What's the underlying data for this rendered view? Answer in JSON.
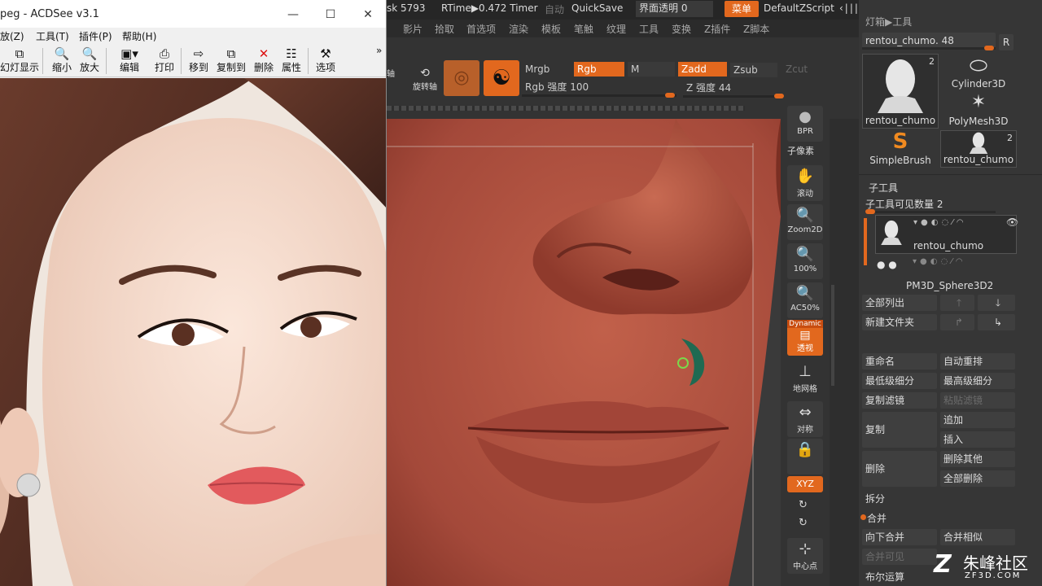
{
  "acdsee": {
    "title": "peg - ACDSee v3.1",
    "menu": [
      "放(Z)",
      "工具(T)",
      "插件(P)",
      "帮助(H)"
    ],
    "toolbar": [
      {
        "icon": "slideshow-icon",
        "label": "幻灯显示"
      },
      {
        "icon": "zoom-out-icon",
        "label": "缩小"
      },
      {
        "icon": "zoom-in-icon",
        "label": "放大"
      },
      {
        "icon": "edit-icon",
        "label": "编辑"
      },
      {
        "icon": "print-icon",
        "label": "打印"
      },
      {
        "icon": "move-to-icon",
        "label": "移到"
      },
      {
        "icon": "copy-to-icon",
        "label": "复制到"
      },
      {
        "icon": "delete-icon",
        "label": "删除"
      },
      {
        "icon": "properties-icon",
        "label": "属性"
      },
      {
        "icon": "options-icon",
        "label": "选项"
      }
    ],
    "more": "»"
  },
  "zbrush": {
    "topbar": {
      "disk": "sk 5793",
      "rtime": "RTime▶0.472 Timer",
      "auto": "自动",
      "quicksave": "QuickSave",
      "transparency": "界面透明 0",
      "menu_btn": "菜单",
      "zscript": "DefaultZScript"
    },
    "menu": [
      "影片",
      "拾取",
      "首选项",
      "渲染",
      "模板",
      "笔触",
      "纹理",
      "工具",
      "变换",
      "Z插件",
      "Z脚本"
    ],
    "shelf": {
      "rotate_label": "旋转轴",
      "left_label": "轴",
      "mrgb": "Mrgb",
      "rgb": "Rgb",
      "m": "M",
      "zadd": "Zadd",
      "zsub": "Zsub",
      "zcut": "Zcut",
      "rgb_intensity": "Rgb 强度 100",
      "z_intensity": "Z 强度 44"
    },
    "right_tools": [
      {
        "icon": "bpr-icon",
        "label": "BPR"
      },
      {
        "icon": "subpixel-label",
        "label": "子像素"
      },
      {
        "icon": "scroll-icon",
        "label": "滚动"
      },
      {
        "icon": "zoom2d-icon",
        "label": "Zoom2D"
      },
      {
        "icon": "100-icon",
        "label": "100%"
      },
      {
        "icon": "ac50-icon",
        "label": "AC50%"
      },
      {
        "icon": "perspective-icon",
        "label": "透视",
        "top": "Dynamic"
      },
      {
        "icon": "floor-icon",
        "label": "地网格"
      },
      {
        "icon": "symmetry-icon",
        "label": "对称"
      },
      {
        "icon": "lock-icon",
        "label": ""
      },
      {
        "icon": "xyz-icon",
        "label": "XYZ"
      },
      {
        "icon": "center-icon",
        "label": "中心点"
      }
    ],
    "panel": {
      "header": "灯箱▶工具",
      "tool_name": "rentou_chumo. 48",
      "r_btn": "R",
      "thumbs": [
        {
          "name": "rentou_chumo",
          "count": "2"
        },
        {
          "name": "Cylinder3D",
          "count": ""
        },
        {
          "name": "PolyMesh3D",
          "count": ""
        },
        {
          "name": "SimpleBrush",
          "count": ""
        },
        {
          "name": "rentou_chumo",
          "count": "2"
        }
      ],
      "subtool_title": "子工具",
      "subtool_count": "子工具可见数量 2",
      "subtools": [
        "rentou_chumo",
        "PM3D_Sphere3D2"
      ],
      "list_all": "全部列出",
      "new_folder": "新建文件夹",
      "rename": "重命名",
      "auto_reorder": "自动重排",
      "lowest_subdiv": "最低级细分",
      "highest_subdiv": "最高级细分",
      "copy_filter": "复制滤镜",
      "paste_filter": "粘贴滤镜",
      "duplicate": "复制",
      "append": "追加",
      "insert": "插入",
      "delete": "删除",
      "delete_other": "删除其他",
      "delete_all": "全部删除",
      "split": "拆分",
      "merge": "合并",
      "merge_down": "向下合并",
      "merge_similar": "合并相似",
      "merge_visible": "合并可见",
      "boolean": "布尔运算"
    }
  },
  "watermark": {
    "main": "朱峰社区",
    "sub": "ZF3D.COM",
    "logo": "Z"
  },
  "colors": {
    "accent": "#e2681e",
    "skin": "#b4533e"
  }
}
